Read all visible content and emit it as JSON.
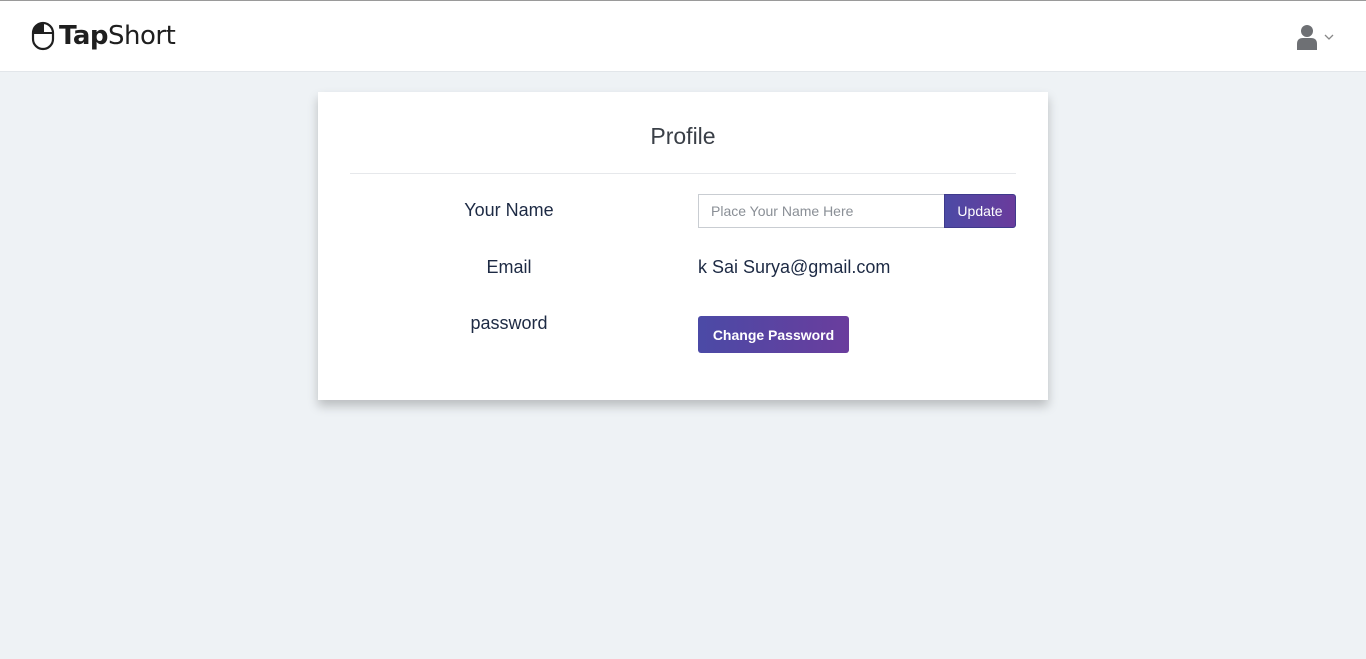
{
  "header": {
    "logo_text_bold": "Tap",
    "logo_text_regular": "Short",
    "logo_icon": "mouse-icon",
    "user_icon": "user-icon",
    "menu_icon": "chevron-down-icon"
  },
  "profile": {
    "title": "Profile",
    "name_label": "Your Name",
    "name_placeholder": "Place Your Name Here",
    "name_value": "",
    "update_label": "Update",
    "email_label": "Email",
    "email_value": "k Sai Surya@gmail.com",
    "password_label": "password",
    "change_password_label": "Change Password"
  },
  "colors": {
    "page_background": "#eef2f5",
    "button_gradient_start": "#4b4aa6",
    "button_gradient_end": "#6a3d9d",
    "text": "#1d2a44"
  }
}
